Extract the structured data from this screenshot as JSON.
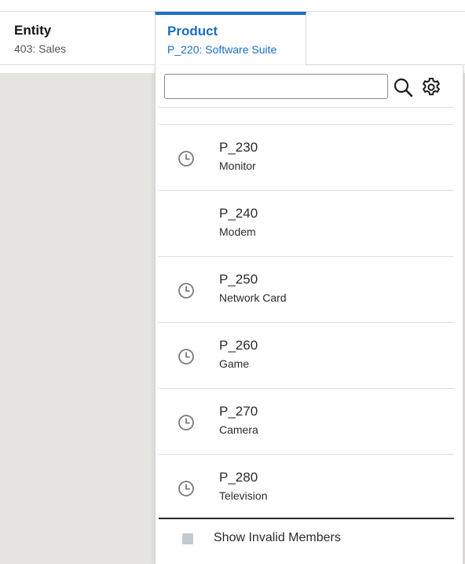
{
  "pov": {
    "entity": {
      "title": "Entity",
      "value": "403: Sales"
    },
    "product": {
      "title": "Product",
      "value": "P_220: Software Suite"
    }
  },
  "search": {
    "value": "",
    "placeholder": "",
    "search_icon": "magnifier-icon",
    "settings_icon": "gear-icon"
  },
  "members": [
    {
      "code": "P_230",
      "name": "Monitor",
      "recent": true
    },
    {
      "code": "P_240",
      "name": "Modem",
      "recent": false
    },
    {
      "code": "P_250",
      "name": "Network Card",
      "recent": true
    },
    {
      "code": "P_260",
      "name": "Game",
      "recent": true
    },
    {
      "code": "P_270",
      "name": "Camera",
      "recent": true
    },
    {
      "code": "P_280",
      "name": "Television",
      "recent": true
    }
  ],
  "footer": {
    "label": "Show Invalid Members",
    "checked": false
  },
  "colors": {
    "accent": "#1f6ec8",
    "background_gray": "#e5e4e1",
    "checkbox": "#c4c9d0"
  }
}
